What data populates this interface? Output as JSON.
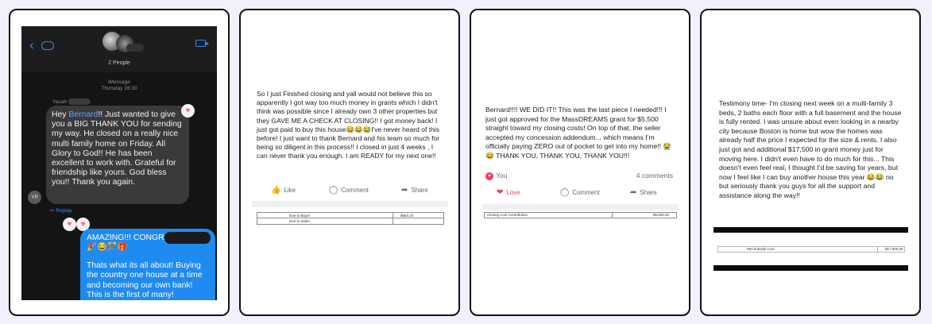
{
  "cards": [
    {
      "type": "imessage",
      "header": {
        "participants": "2 People"
      },
      "timestamp": {
        "service": "iMessage",
        "time": "Thursday 16:30"
      },
      "incoming": {
        "sender": "Yasah",
        "avatar_initials": "YP",
        "text_prefix": "Hey ",
        "mention": "Bernard",
        "text_rest": "!! Just wanted to give you a BIG THANK YOU for sending my way. He closed on a really nice multi family home on Friday. All Glory to God!! He has been excellent to work with. Grateful for friendship like yours. God bless you!! Thank you again.",
        "reaction": "♥",
        "reply_label": "Replay"
      },
      "outgoing": {
        "line1": "AMAZING!!! CONGRATS",
        "emojis": "🎉😂🎊🎁",
        "text": "Thats what its all about! Buying the country one house at a time and becoming our own bank! This is the first of many!",
        "reactions": [
          "♥",
          "♥"
        ]
      },
      "colors": {
        "incoming_bubble": "#3a3a3c",
        "outgoing_bubble": "#1f8bf0",
        "mention": "#60a5fa"
      }
    },
    {
      "type": "facebook_post",
      "text": "So I just Finished closing and yall would not believe this so apparently I got way too much money in grants which I didn't think was possible since I already own 3 other properties but they GAVE ME A CHECK AT CLOSING!! I got money back! I just got paid to buy this house😂😂😂I've never heard of this before! I just want to thank Bernard and his team so much for being so diligent in this process!! I closed in just 4 weeks , I can never thank you enough. I am READY for my next one!!",
      "actions": {
        "like": "Like",
        "comment": "Comment",
        "share": "Share"
      },
      "table": [
        {
          "label": "Due to Buyer",
          "value": "$584.33"
        },
        {
          "label": "Due to Seller",
          "value": ""
        }
      ]
    },
    {
      "type": "facebook_post",
      "text": "Bernard!!!! WE DID IT!! This was the last piece I needed!!! I just got approved for the MassDREAMS grant for $5,500 straight toward my closing costs! On top of that, the seller accepted my concession addendum... which means I'm officially paying ZERO out of pocket to get into my home!! 😭😂 THANK YOU, THANK YOU, THANK YOU!!!",
      "meta": {
        "reactor": "You",
        "comments": "4 comments"
      },
      "actions": {
        "love": "Love",
        "comment": "Comment",
        "share": "Share"
      },
      "table": [
        {
          "label": "Closing Cost Contribution",
          "value": "$5,500.00"
        }
      ]
    },
    {
      "type": "testimony",
      "text": "Testimony time- I'm closing next week on a multi-family 3 beds, 2 baths each floor with a full basement and the house is fully rented. I was unsure about even looking in a nearby city because Boston is home but wow the homes was already half the price I expected for the size & rents. I also just got and additional $17,500 in grant money just for moving here. I didn't even have to do much for this... This doesn't even feel real, I thought I'd be saving for years, but now I feel like I can buy another house this year 😂😂 no but seriously thank you guys for all the support and assistance along the way!!",
      "table": [
        {
          "label": "MH Subsidy Cost",
          "value": "$17,500.00"
        }
      ]
    }
  ]
}
